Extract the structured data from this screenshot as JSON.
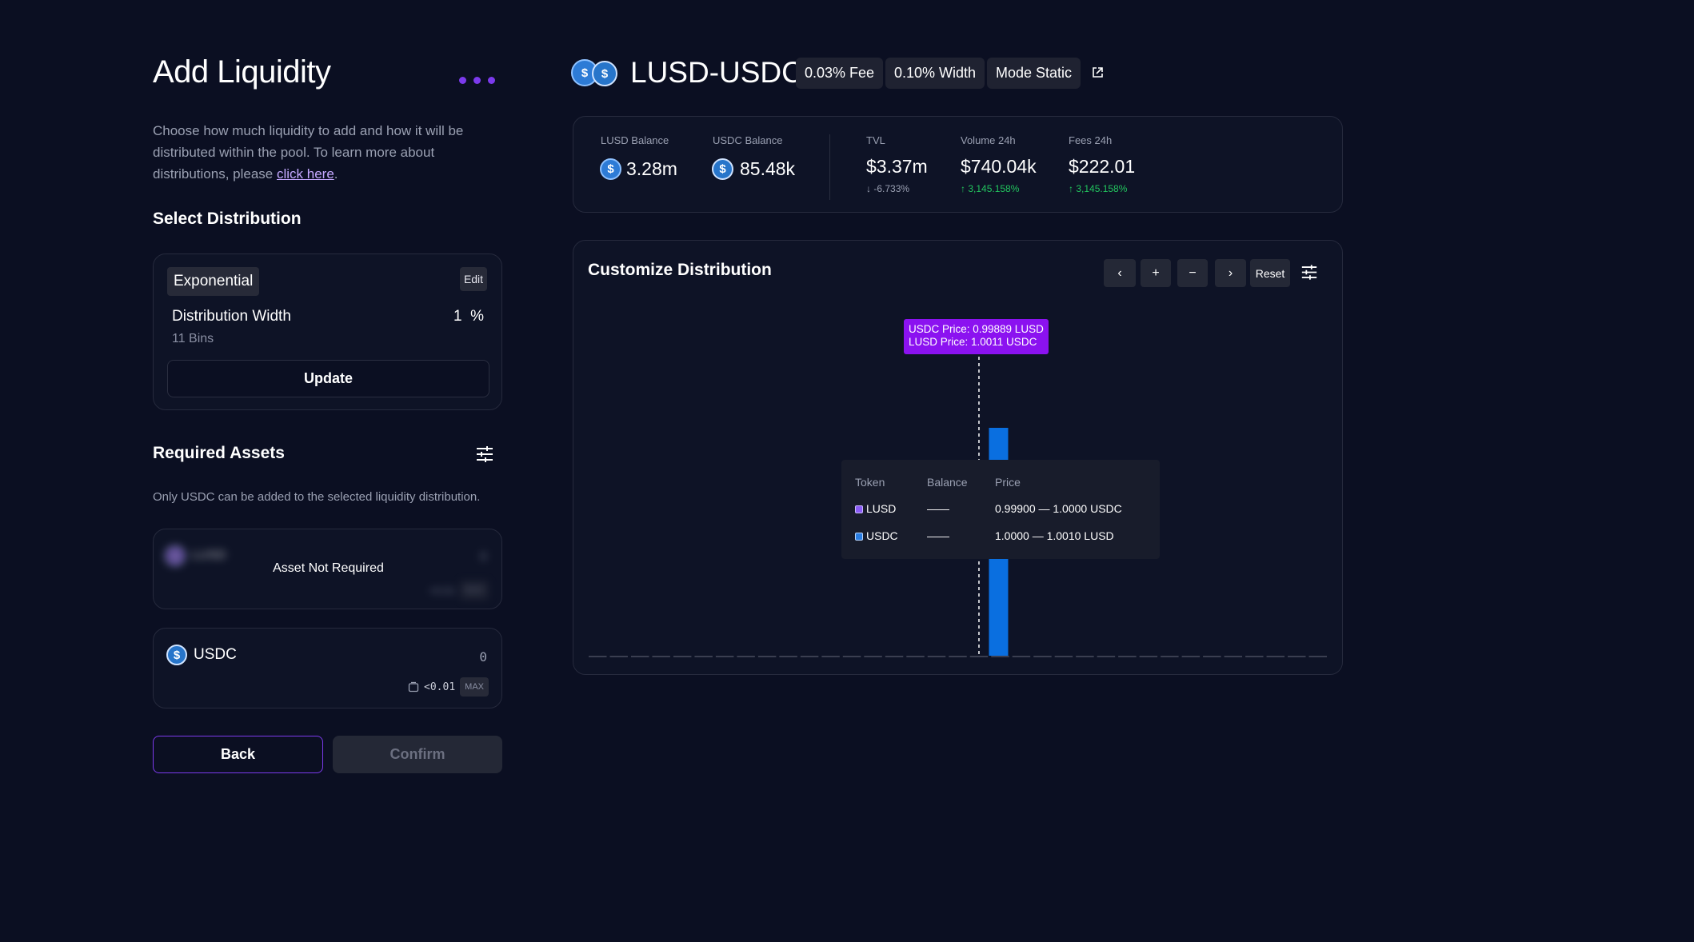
{
  "left": {
    "title": "Add Liquidity",
    "intro_text": "Choose how much liquidity to add and how it will be distributed within the pool. To learn more about distributions, please ",
    "intro_link": "click here",
    "intro_end": ".",
    "select_distribution_title": "Select Distribution",
    "distribution": {
      "name": "Exponential",
      "edit_label": "Edit",
      "width_label": "Distribution Width",
      "width_value": "1",
      "width_unit": "%",
      "bins_label": "11 Bins",
      "update_label": "Update"
    },
    "required_assets_title": "Required Assets",
    "required_note": "Only USDC can be added to the selected liquidity distribution.",
    "lusd_card": {
      "token": "LUSD",
      "status": "Asset Not Required",
      "amount": "0",
      "balance": "<0.01",
      "max_label": "MAX"
    },
    "usdc_card": {
      "token": "USDC",
      "amount": "0",
      "balance": "<0.01",
      "max_label": "MAX"
    },
    "back_label": "Back",
    "confirm_label": "Confirm"
  },
  "pool": {
    "pair": "LUSD-USDC",
    "fee_pill": "0.03% Fee",
    "width_pill": "0.10% Width",
    "mode_pill": "Mode Static"
  },
  "stats": {
    "lusd_balance_label": "LUSD Balance",
    "lusd_balance": "3.28m",
    "usdc_balance_label": "USDC Balance",
    "usdc_balance": "85.48k",
    "tvl_label": "TVL",
    "tvl": "$3.37m",
    "tvl_change": "-6.733%",
    "volume_label": "Volume 24h",
    "volume": "$740.04k",
    "volume_change": "3,145.158%",
    "fees_label": "Fees 24h",
    "fees": "$222.01",
    "fees_change": "3,145.158%"
  },
  "customize": {
    "title": "Customize Distribution",
    "controls": {
      "prev": "‹",
      "zoom_in": "+",
      "zoom_out": "−",
      "next": "›",
      "reset": "Reset"
    },
    "price_tooltip": {
      "line1": "USDC Price:  0.99889 LUSD",
      "line2": "LUSD Price:  1.0011 USDC"
    },
    "legend": {
      "h_token": "Token",
      "h_balance": "Balance",
      "h_price": "Price",
      "rows": [
        {
          "token": "LUSD",
          "balance": "——",
          "price": "0.99900 — 1.0000 USDC",
          "color": "#8b5cf6"
        },
        {
          "token": "USDC",
          "balance": "——",
          "price": "1.0000 — 1.0010 LUSD",
          "color": "#2a7de1"
        }
      ]
    }
  },
  "chart_data": {
    "type": "bar",
    "bins": 35,
    "active_bin_index": 19,
    "values": [
      0,
      0,
      0,
      0,
      0,
      0,
      0,
      0,
      0,
      0,
      0,
      0,
      0,
      0,
      0,
      0,
      0,
      0,
      0,
      1,
      0,
      0,
      0,
      0,
      0,
      0,
      0,
      0,
      0,
      0,
      0,
      0,
      0,
      0,
      0
    ],
    "current_price_bin": 18,
    "colors": {
      "usdc": "#0a6fe0",
      "baseline": "#3a3e50"
    }
  }
}
